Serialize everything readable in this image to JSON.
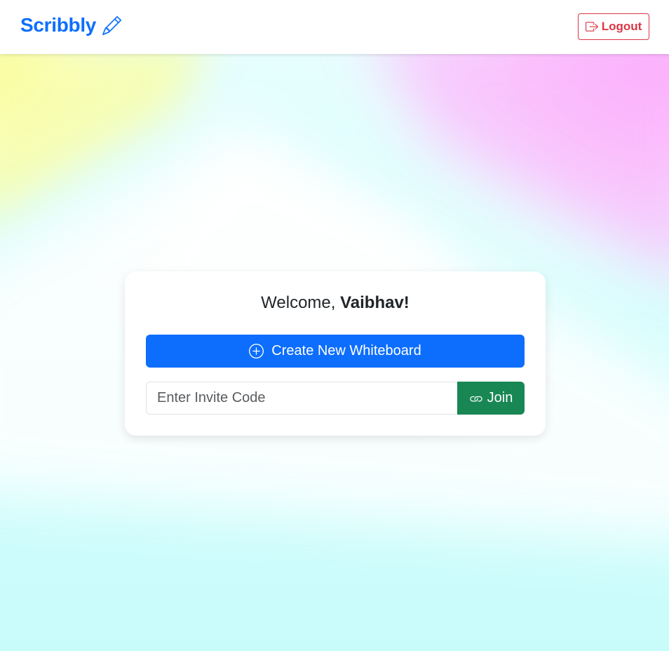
{
  "navbar": {
    "brand": "Scribbly",
    "brand_icon": "pencil-icon",
    "logout_label": "Logout",
    "logout_icon": "box-arrow-right-icon"
  },
  "card": {
    "welcome_prefix": "Welcome, ",
    "user_name": "Vaibhav!",
    "create_label": "Create New Whiteboard",
    "create_icon": "plus-circle-icon",
    "invite_placeholder": "Enter Invite Code",
    "invite_value": "",
    "join_label": "Join",
    "join_icon": "link-icon"
  },
  "colors": {
    "primary": "#0d6efd",
    "danger": "#dc3545",
    "success": "#198754",
    "bg_yellow": "#fafd9e",
    "bg_pink": "#fca6fc",
    "bg_cyan": "#cffdfc"
  }
}
